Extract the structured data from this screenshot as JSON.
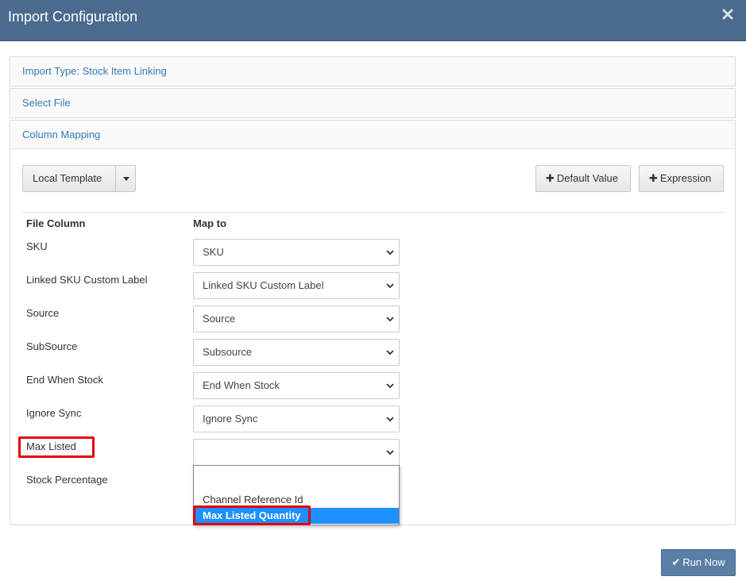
{
  "modal": {
    "title": "Import Configuration"
  },
  "sections": {
    "import_type": "Import Type: Stock Item Linking",
    "select_file": "Select File",
    "column_mapping": "Column Mapping"
  },
  "toolbar": {
    "template_label": "Local Template",
    "default_value_label": "Default Value",
    "expression_label": "Expression"
  },
  "table": {
    "file_column_header": "File Column",
    "map_to_header": "Map to",
    "rows": [
      {
        "file_column": "SKU",
        "map_to": "SKU"
      },
      {
        "file_column": "Linked SKU Custom Label",
        "map_to": "Linked SKU Custom Label"
      },
      {
        "file_column": "Source",
        "map_to": "Source"
      },
      {
        "file_column": "SubSource",
        "map_to": "Subsource"
      },
      {
        "file_column": "End When Stock",
        "map_to": "End When Stock"
      },
      {
        "file_column": "Ignore Sync",
        "map_to": "Ignore Sync"
      },
      {
        "file_column": "Max Listed",
        "map_to": ""
      },
      {
        "file_column": "Stock Percentage",
        "map_to": ""
      }
    ]
  },
  "dropdown": {
    "options": [
      "",
      "Channel Reference Id",
      "Max Listed Quantity"
    ],
    "highlighted": "Max Listed Quantity"
  },
  "footer": {
    "run_label": "Run Now"
  },
  "colors": {
    "header_bg": "#4a6a8e",
    "link": "#337ab7",
    "highlight_border": "#e3000f",
    "selected_option_bg": "#1e90ff",
    "run_button_bg": "#5a7ea4"
  },
  "icons": {
    "close": "close-icon",
    "caret": "caret-down-icon",
    "plus": "plus-icon",
    "chevron": "chevron-down-icon",
    "check": "check-icon"
  }
}
